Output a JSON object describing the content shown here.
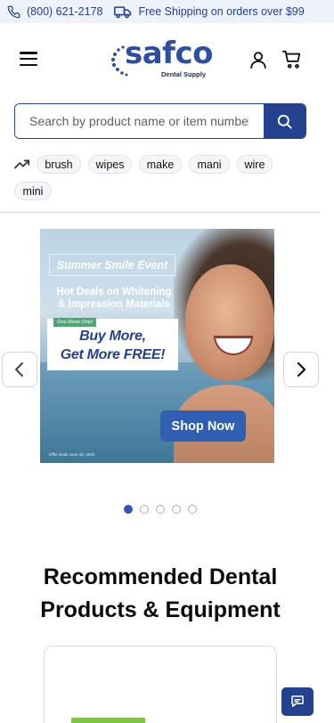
{
  "topbar": {
    "phone": "(800) 621-2178",
    "shipping": "Free Shipping on orders over $99"
  },
  "header": {
    "logo_text": "safco",
    "logo_sub": "Dental Supply"
  },
  "search": {
    "placeholder": "Search by product name or item number"
  },
  "trending": {
    "tags": [
      "brush",
      "wipes",
      "make",
      "mani",
      "wire",
      "mini"
    ]
  },
  "banner": {
    "title": "Summer Smile Event",
    "subtitle_line1": "Hot Deals on Whitening",
    "subtitle_line2": "& Impression Materials",
    "tag": "One Week Only!",
    "offer_line1": "Buy More,",
    "offer_line2": "Get More FREE!",
    "cta": "Shop Now",
    "fine_print": "Offer Ends June 30, 2025"
  },
  "carousel": {
    "slide_count": 5,
    "active_index": 0
  },
  "section": {
    "heading_line1": "Recommended Dental",
    "heading_line2": "Products & Equipment"
  },
  "colors": {
    "brand": "#24418f",
    "topbar_bg": "#eef2fb",
    "shop_button": "#2e5fb2"
  }
}
